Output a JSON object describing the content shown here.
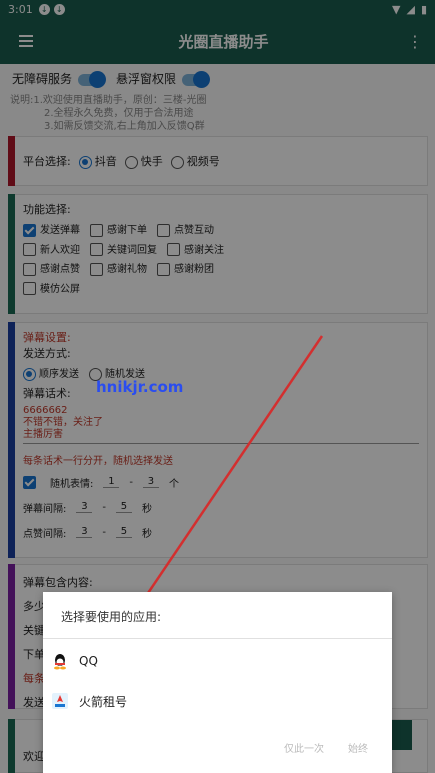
{
  "status": {
    "time": "3:01"
  },
  "appbar": {
    "title": "光圈直播助手"
  },
  "toggles": [
    {
      "label": "无障碍服务"
    },
    {
      "label": "悬浮窗权限"
    }
  ],
  "desc": [
    "说明:1.欢迎使用直播助手，原创：三楼-光圈",
    "2.全程永久免费，仅用于合法用途",
    "3.如需反馈交流,右上角加入反馈Q群"
  ],
  "platform": {
    "label": "平台选择:",
    "options": [
      "抖音",
      "快手",
      "视频号"
    ],
    "selected": "抖音"
  },
  "features": {
    "label": "功能选择:",
    "items": [
      {
        "label": "发送弹幕",
        "checked": true
      },
      {
        "label": "感谢下单",
        "checked": false
      },
      {
        "label": "点赞互动",
        "checked": false
      },
      {
        "label": "新人欢迎",
        "checked": false
      },
      {
        "label": "关键词回复",
        "checked": false
      },
      {
        "label": "感谢关注",
        "checked": false
      },
      {
        "label": "感谢点赞",
        "checked": false
      },
      {
        "label": "感谢礼物",
        "checked": false
      },
      {
        "label": "感谢粉团",
        "checked": false
      },
      {
        "label": "模仿公屏",
        "checked": false
      }
    ]
  },
  "danmu": {
    "title": "弹幕设置:",
    "send_mode_label": "发送方式:",
    "modes": [
      "顺序发送",
      "随机发送"
    ],
    "selected_mode": "顺序发送",
    "script_label": "弹幕话术:",
    "lines": [
      "6666662",
      "不错不错，关注了",
      "主播厉害"
    ],
    "hint": "每条话术一行分开，随机选择发送",
    "emoji_label": "随机表情:",
    "emoji_min": "1",
    "emoji_max": "3",
    "emoji_unit": "个",
    "interval_label": "弹幕间隔:",
    "interval_min": "3",
    "interval_max": "5",
    "sec": "秒",
    "like_label": "点赞间隔:",
    "like_min": "3",
    "like_max": "5"
  },
  "lower": {
    "contains_label": "弹幕包含内容:",
    "partial1": "多少",
    "partial2": "关键",
    "partial3": "下单",
    "partial4": "每条",
    "partial5": "发送",
    "partial6": "欢迎"
  },
  "watermark": "hnikjr.com",
  "dialog": {
    "title": "选择要使用的应用:",
    "options": [
      {
        "label": "QQ",
        "icon": "qq-icon"
      },
      {
        "label": "火箭租号",
        "icon": "rocket-app-icon"
      }
    ],
    "just_once": "仅此一次",
    "always": "始终"
  },
  "colors": {
    "primary": "#1b5e4f",
    "accent": "#1976d2",
    "arrow": "#d32f2f"
  }
}
